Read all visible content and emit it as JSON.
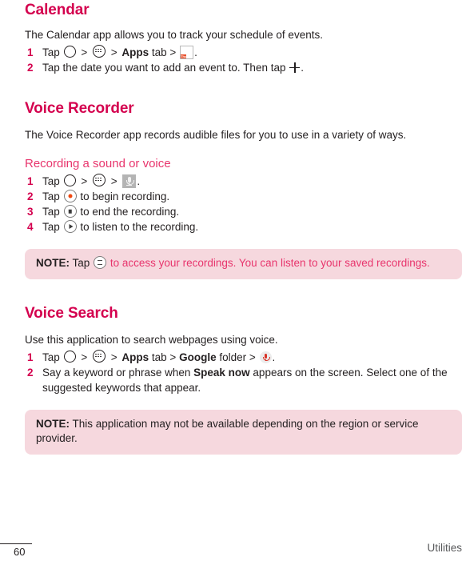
{
  "page": {
    "number": "60",
    "running_head": "Utilities"
  },
  "sections": [
    {
      "id": "calendar",
      "title": "Calendar",
      "intro": "The Calendar app allows you to track your schedule of events.",
      "steps": [
        {
          "num": "1",
          "pre": "Tap",
          "icons": [
            "home-icon",
            "apps-icon",
            "calendar-app-icon"
          ],
          "mid1": ">",
          "apps_label": "Apps",
          "tab_word": "tab >",
          "period": "."
        },
        {
          "num": "2",
          "text_before": "Tap the date you want to add an event to. Then tap",
          "icon": "plus-icon",
          "period": "."
        }
      ]
    },
    {
      "id": "voice-recorder",
      "title": "Voice Recorder",
      "intro": "The Voice Recorder app records audible files for you to use in a variety of ways.",
      "subtitle": "Recording a sound or voice",
      "steps": [
        {
          "num": "1",
          "pre": "Tap",
          "period": "."
        },
        {
          "num": "2",
          "pre": "Tap",
          "post": "to begin recording.",
          "icon": "record-button-icon"
        },
        {
          "num": "3",
          "pre": "Tap",
          "post": "to end the recording.",
          "icon": "stop-button-icon"
        },
        {
          "num": "4",
          "pre": "Tap",
          "post": "to listen to the recording.",
          "icon": "play-button-icon"
        }
      ],
      "note": {
        "label": "NOTE:",
        "text_before": "Tap",
        "icon": "list-button-icon",
        "text_after": "to access your recordings. You can listen to your saved recordings."
      }
    },
    {
      "id": "voice-search",
      "title": "Voice Search",
      "intro": "Use this application to search webpages using voice.",
      "steps": [
        {
          "num": "1",
          "pre": "Tap",
          "apps_label": "Apps",
          "tab_word": "tab >",
          "google_label": "Google",
          "folder_word": "folder >",
          "icon": "google-mic-icon",
          "period": "."
        },
        {
          "num": "2",
          "text_a": "Say a keyword or phrase when",
          "bold": "Speak now",
          "text_b": "appears on the screen. Select one of the suggested keywords that appear."
        }
      ],
      "note": {
        "label": "NOTE:",
        "text": "This application may not be available depending on the region or service provider."
      }
    }
  ],
  "icons": {
    "calendar_weekday": "Thu",
    "calendar_date": "17"
  },
  "colors": {
    "heading": "#d4004e",
    "subheading": "#e8356d",
    "note_bg": "#f6d8de",
    "body": "#231f20"
  }
}
